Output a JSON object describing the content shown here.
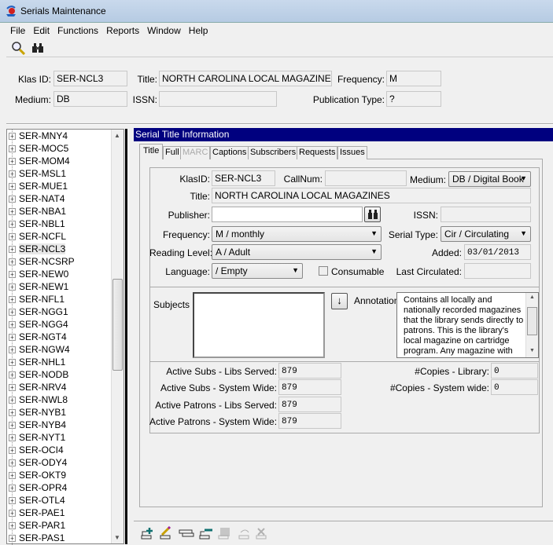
{
  "window": {
    "title": "Serials Maintenance"
  },
  "menu": [
    "File",
    "Edit",
    "Functions",
    "Reports",
    "Window",
    "Help"
  ],
  "header": {
    "klas_id_label": "Klas ID:",
    "klas_id": "SER-NCL3",
    "title_label": "Title:",
    "title": "NORTH CAROLINA LOCAL MAGAZINES",
    "frequency_label": "Frequency:",
    "frequency": "M",
    "medium_label": "Medium:",
    "medium": "DB",
    "issn_label": "ISSN:",
    "issn": "",
    "pubtype_label": "Publication Type:",
    "pubtype": "?"
  },
  "tree": {
    "items": [
      "SER-MNY4",
      "SER-MOC5",
      "SER-MOM4",
      "SER-MSL1",
      "SER-MUE1",
      "SER-NAT4",
      "SER-NBA1",
      "SER-NBL1",
      "SER-NCFL",
      "SER-NCL3",
      "SER-NCSRP",
      "SER-NEW0",
      "SER-NEW1",
      "SER-NFL1",
      "SER-NGG1",
      "SER-NGG4",
      "SER-NGT4",
      "SER-NGW4",
      "SER-NHL1",
      "SER-NODB",
      "SER-NRV4",
      "SER-NWL8",
      "SER-NYB1",
      "SER-NYB4",
      "SER-NYT1",
      "SER-OCI4",
      "SER-ODY4",
      "SER-OKT9",
      "SER-OPR4",
      "SER-OTL4",
      "SER-PAE1",
      "SER-PAR1",
      "SER-PAS1"
    ],
    "selected": "SER-NCL3"
  },
  "panel": {
    "title": "Serial Title Information",
    "tabs": [
      "Title",
      "Full",
      "MARC",
      "Captions",
      "Subscribers",
      "Requests",
      "Issues"
    ],
    "form": {
      "klasid_label": "KlasID:",
      "klasid": "SER-NCL3",
      "callnum_label": "CallNum:",
      "callnum": "",
      "medium_label": "Medium:",
      "medium": "DB / Digital Book",
      "title_label": "Title:",
      "title": "NORTH CAROLINA LOCAL MAGAZINES",
      "publisher_label": "Publisher:",
      "publisher": "",
      "issn_label": "ISSN:",
      "issn": "",
      "frequency_label": "Frequency:",
      "frequency": "M / monthly",
      "serial_type_label": "Serial Type:",
      "serial_type": "Cir / Circulating",
      "reading_level_label": "Reading Level:",
      "reading_level": "A / Adult",
      "added_label": "Added:",
      "added": "03/01/2013",
      "language_label": "Language:",
      "language": " / Empty",
      "consumable_label": "Consumable",
      "last_circ_label": "Last Circulated:",
      "last_circ": "",
      "subjects_label": "Subjects",
      "annotation_label": "Annotation",
      "annotation": "Contains all locally and nationally recorded magazines that the library sends directly to patrons. This is the library's local magazine on cartridge program. Any magazine with \"C\" media"
    },
    "stats": [
      {
        "label": "Active Subs - Libs Served:",
        "value": "879"
      },
      {
        "label": "Active Subs - System Wide:",
        "value": "879"
      },
      {
        "label": "Active Patrons - Libs Served:",
        "value": "879"
      },
      {
        "label": "Active Patrons - System Wide:",
        "value": "879"
      }
    ],
    "copies": [
      {
        "label": "#Copies - Library:",
        "value": "0"
      },
      {
        "label": "#Copies - System wide:",
        "value": "0"
      }
    ]
  }
}
